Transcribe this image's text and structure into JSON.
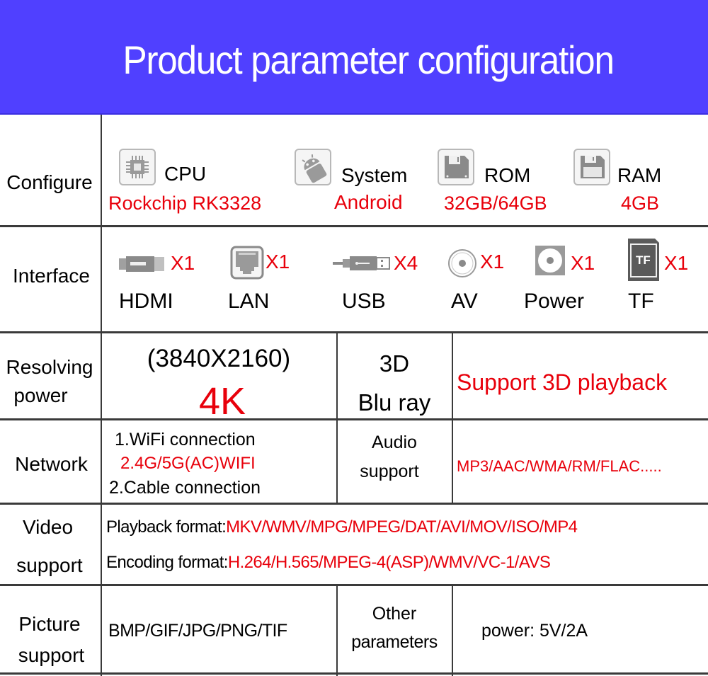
{
  "header": {
    "title": "Product parameter configuration"
  },
  "colors": {
    "banner": "#5040ff",
    "accent_red": "#e8000b",
    "grid_line": "#3a3a3a"
  },
  "rows": {
    "configure": {
      "label": "Configure",
      "items": [
        {
          "icon": "cpu-chip-icon",
          "name": "CPU",
          "value": "Rockchip RK3328"
        },
        {
          "icon": "android-icon",
          "name": "System",
          "value": "Android"
        },
        {
          "icon": "floppy-disk-icon",
          "name": "ROM",
          "value": "32GB/64GB"
        },
        {
          "icon": "floppy-disk-icon",
          "name": "RAM",
          "value": "4GB"
        }
      ]
    },
    "interface": {
      "label": "Interface",
      "items": [
        {
          "icon": "hdmi-connector-icon",
          "name": "HDMI",
          "count": "X1"
        },
        {
          "icon": "ethernet-port-icon",
          "name": "LAN",
          "count": "X1"
        },
        {
          "icon": "usb-connector-icon",
          "name": "USB",
          "count": "X4"
        },
        {
          "icon": "av-jack-icon",
          "name": "AV",
          "count": "X1"
        },
        {
          "icon": "power-jack-icon",
          "name": "Power",
          "count": "X1"
        },
        {
          "icon": "tf-card-icon",
          "name": "TF",
          "count": "X1",
          "icon_text": "TF"
        }
      ]
    },
    "resolving": {
      "label_line1": "Resolving",
      "label_line2": "power",
      "resolution": "(3840X2160)",
      "resolution_name": "4K",
      "format_line1": "3D",
      "format_line2": "Blu ray",
      "feature": "Support 3D playback"
    },
    "network": {
      "label": "Network",
      "line1": "1.WiFi connection",
      "line2": "2.4G/5G(AC)WIFI",
      "line3": "2.Cable connection",
      "audio_label_line1": "Audio",
      "audio_label_line2": "support",
      "audio_formats": "MP3/AAC/WMA/RM/FLAC....."
    },
    "video": {
      "label_line1": "Video",
      "label_line2": "support",
      "playback_label": "Playback format:",
      "playback_value": "MKV/WMV/MPG/MPEG/DAT/AVI/MOV/ISO/MP4",
      "encoding_label": "Encoding format:",
      "encoding_value": "H.264/H.565/MPEG-4(ASP)/WMV/VC-1/AVS"
    },
    "picture": {
      "label_line1": "Picture",
      "label_line2": "support",
      "formats": "BMP/GIF/JPG/PNG/TIF",
      "other_label_line1": "Other",
      "other_label_line2": "parameters",
      "power": "power: 5V/2A"
    }
  }
}
